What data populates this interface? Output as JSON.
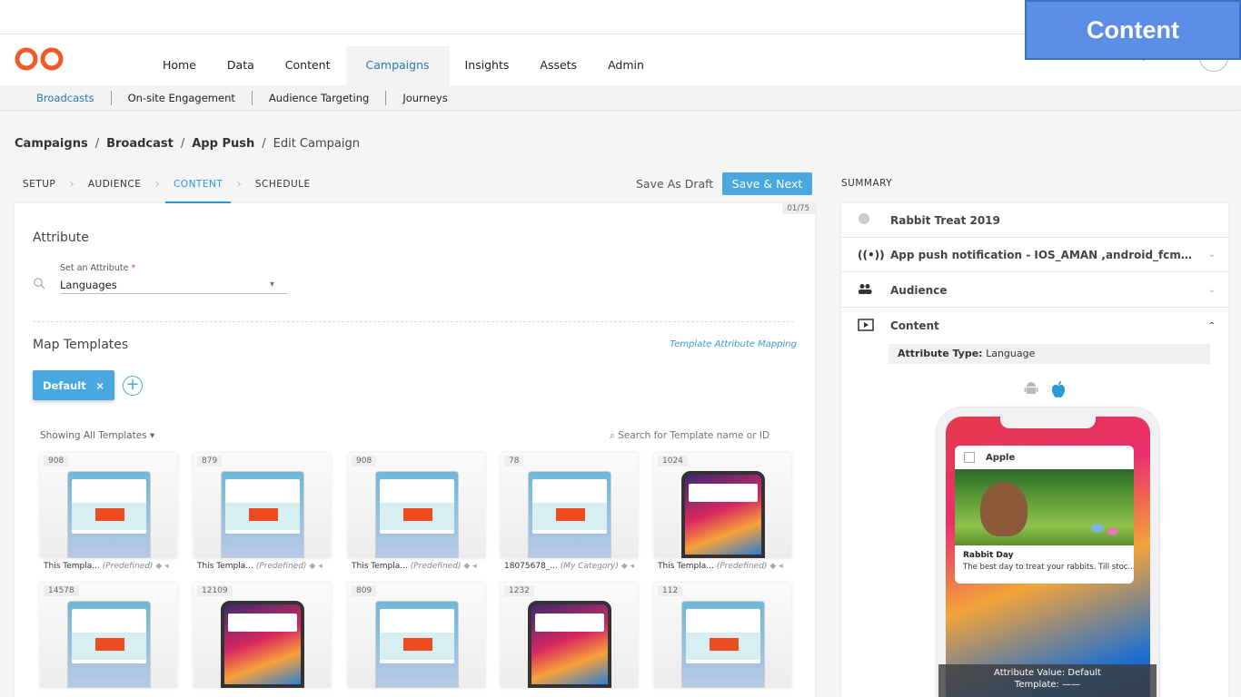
{
  "banner": {
    "label": "Content"
  },
  "nav": {
    "items": [
      {
        "label": "Home"
      },
      {
        "label": "Data"
      },
      {
        "label": "Content"
      },
      {
        "label": "Campaigns",
        "active": true
      },
      {
        "label": "Insights"
      },
      {
        "label": "Assets"
      },
      {
        "label": "Admin"
      }
    ],
    "help_glyph": "?"
  },
  "subnav": {
    "items": [
      {
        "label": "Broadcasts",
        "active": true
      },
      {
        "label": "On-site Engagement"
      },
      {
        "label": "Audience Targeting"
      },
      {
        "label": "Journeys"
      }
    ]
  },
  "breadcrumb": {
    "items": [
      "Campaigns",
      "Broadcast",
      "App Push"
    ],
    "current": "Edit Campaign",
    "separator": "/"
  },
  "steps": {
    "items": [
      {
        "label": "SETUP"
      },
      {
        "label": "AUDIENCE"
      },
      {
        "label": "CONTENT",
        "active": true
      },
      {
        "label": "SCHEDULE"
      }
    ]
  },
  "actions": {
    "draft_label": "Save As Draft",
    "save_label": "Save & Next"
  },
  "summary_label": "SUMMARY",
  "main": {
    "counter": "01/75",
    "attribute_title": "Attribute",
    "attribute_field_label": "Set an Attribute",
    "attribute_required": "*",
    "attribute_value": "Languages",
    "map_templates_title": "Map Templates",
    "mapping_link": "Template Attribute Mapping",
    "default_tab_label": "Default",
    "default_tab_close": "×",
    "add_tab_glyph": "+",
    "showing_label": "Showing All Templates",
    "search_placeholder": "Search for Template name or ID"
  },
  "templates": [
    {
      "count": "908",
      "type": "android",
      "name": "This Templa...",
      "category": "(Predefined)"
    },
    {
      "count": "879",
      "type": "android",
      "name": "This Templa...",
      "category": "(Predefined)"
    },
    {
      "count": "908",
      "type": "android",
      "name": "This Templa...",
      "category": "(Predefined)"
    },
    {
      "count": "78",
      "type": "android-dark",
      "name": "18075678_...",
      "category": "(My Category)"
    },
    {
      "count": "1024",
      "type": "iphone",
      "name": "This Templa...",
      "category": "(Predefined)"
    },
    {
      "count": "14578",
      "type": "android-dark",
      "name": "",
      "category": ""
    },
    {
      "count": "12109",
      "type": "iphone",
      "name": "",
      "category": ""
    },
    {
      "count": "809",
      "type": "android",
      "name": "",
      "category": ""
    },
    {
      "count": "1232",
      "type": "iphone",
      "name": "",
      "category": ""
    },
    {
      "count": "112",
      "type": "android-dark",
      "name": "",
      "category": ""
    }
  ],
  "summary": {
    "campaign_name": "Rabbit Treat 2019",
    "channel": "App push notification - IOS_AMAN ,android_fcm_...",
    "audience_label": "Audience",
    "content_label": "Content",
    "attribute_type_label": "Attribute Type:",
    "attribute_type_value": "Language",
    "preview": {
      "app_name": "Apple",
      "title": "Rabbit Day",
      "message": "The best day to treat your rabbits. Till stoc...",
      "attr_value_label": "Attribute Value:",
      "attr_value": "Default",
      "template_label": "Template:",
      "template_value": "——"
    }
  },
  "colors": {
    "accent": "#4aa8e0",
    "banner": "#5b8fe6",
    "logo": "#f05a28"
  }
}
